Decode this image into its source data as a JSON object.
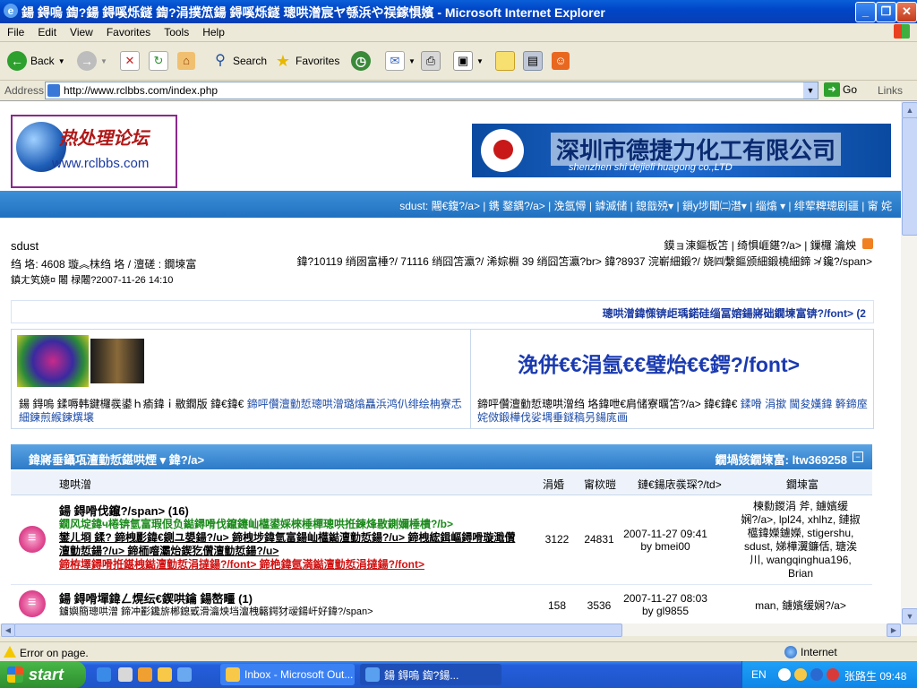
{
  "window": {
    "title": "鍚    鍀嗚  鍧?鍚    鍀嗘烁鐩    鍧?涓撲笟鍚    鍀嗘烁鐩    璁哄潧宸ヤ綔浜や祦鎵惧嬪 - Microsoft Internet Explorer",
    "minimize": "_",
    "maximize": "❐",
    "close": "✕"
  },
  "menu": [
    "File",
    "Edit",
    "View",
    "Favorites",
    "Tools",
    "Help"
  ],
  "toolbar": {
    "back": "Back",
    "search": "Search",
    "favorites": "Favorites"
  },
  "address": {
    "label": "Address",
    "url": "http://www.rclbbs.com/index.php",
    "go": "Go",
    "links": "Links"
  },
  "header": {
    "logo_cn": "热处理论坛",
    "logo_site": "www.rclbbs.com",
    "banner_cn": "深圳市德捷力化工有限公司",
    "banner_pinyin": "shenzhen shi dejieli huagong co.,LTD"
  },
  "navbar": {
    "text": "sdust: 闀€鍑?/a>  | 鎸 鍪鍝?/a> | 浼氬憳 | 鎼滅储 | 鎴戠殑▾ | 鎻у埗闈㈡澘▾ | 缁熻 ▾ | 绯荤粺璁剧疆 | 甯 姹"
  },
  "user": {
    "name": "sdust",
    "line2": "绉  垎: 4608 璇︽枺绉  垎 / 澶磋  : 鐗堜富",
    "line3": "鎮ㄤ笂娆¤  闂  椂闂?2007-11-26 14:10",
    "topright": "鏌ョ湅鏂板笘 | 绮惧崕鍖?/a> | 鏁欏  瀹炴",
    "stats": "鍏?10119 绡囦富棰?/ 71116 绡囧笘瀛?/ 浠婃棩 39 绡囧笘瀛?br> 鍏?8937 浣嶄細鍛?/ 娆㈣繋鏂颁細鍛橈細鍗  ≯ 鑱?/span>"
  },
  "notice": "璁哄潧鍏憡锛歫瑀鍩硅缁冨嫆鍚嶈础鐗堜富锛?/font> (2",
  "ad": {
    "big_text": "浼併€€涓氬€€璧炲€€鍔?/font>",
    "left_text_plain": "鍚    鍀嗚  鍒嗕韩鍵欏彂鍙ｈ瘉鍏ｉ敭鐗版 鍏€鍏€",
    "left_text_link": "鍗呯儹澶勭悊璁哄潧璐熻矗浜鸿仈绯绘柟寮忎細鍊煎緱鍊熼壌",
    "right_text_plain": "鍗呯儹澶勭悊璁哄潧绉  垎鍏呭€肩储寮曞笘?/a> 鍏€鍏€",
    "right_text_link": "鍒嗗  涓撳  閫夋嫨鍏  簳鍗庢姹傚鍛樺伐娑堣垂鐩稿叧鍚庣画"
  },
  "forum": {
    "header_title": "鍏嶈垂鑷瓨澶勭悊鍖哄煙 ▾ 鍏?/a>",
    "header_mod": "鐗堝姟鐗堜富: ltw369258",
    "collapse": "−",
    "columns": {
      "forum": "璁哄潧",
      "topics": "涓婚",
      "posts": "甯栨暟",
      "last_post": "鏈€鍚庡彂琛?/td>",
      "moderators": "鐗堜富"
    },
    "rows": [
      {
        "title": "鍚    鍀嗗伐鑹?/span> (16)",
        "desc_green": "鐗风埞鍏ч棬锛氫富瑕佷负鐑鐞嗗伐鑹鑳屾櫙鍙婇棶棰樿璁哄拰鍊烽敭鍘嬭棰樻?/b>",
        "desc_links": "鐢ㄦ埛    鍒? 鍗栧彲鍏€鍘ユ嫢鍚?/u> 鍗栧埗鍏氫富鍚屾櫙鐑澶勭悊鍚?/u> 鍗栧綋鍓嶇鐞嗗璇濈儹澶勭悊鍚?/u> 鍗栭噾灞炲鍥犵儹澶勭悊鍚?/u>",
        "desc_red": "鍗栫墿鐞嗗拰鍖栧鐑澶勭悊涓撻鍚?/font> 鍗栬鍏氬満鐑澶勭悊涓撻鍚?/font>",
        "topics": "3122",
        "posts": "24831",
        "last_date": "2007-11-27 09:41",
        "last_by": "by bmei00",
        "mods": "楝勬鍐涓    斧, 鐪嬪缓娴?/a>, lpl24, xhlhz, 鏈掓櫙鍏嬫鐪嬫, stigershu, sdust, 娣樺瀷鐮佸, 瑭涘川, wangqinghua196, Brian"
      },
      {
        "title": "鍚    鍀嗗墠鍏ㄥ熀纭€鍥哄鑰    鍚嶅疅 (1)",
        "desc_plain": "鐪嬩簡璁哄潧    鍗冲彲鑱旂郴鎴戜滑瀹炴垱澶栧簵鍔犲叆鍚屽好鍏?/span>",
        "topics": "158",
        "posts": "3536",
        "last_date": "2007-11-27 08:03",
        "last_by": "by gl9855",
        "mods": "man, 鐪嬪缓娴?/a>"
      }
    ]
  },
  "status": {
    "message": "Error on page.",
    "zone": "Internet"
  },
  "taskbar": {
    "start": "start",
    "task1": "Inbox - Microsoft Out...",
    "task2": "鍚    鍀嗚  鍧?鍚...",
    "lang": "EN",
    "user_time": "张路生 09:48"
  }
}
